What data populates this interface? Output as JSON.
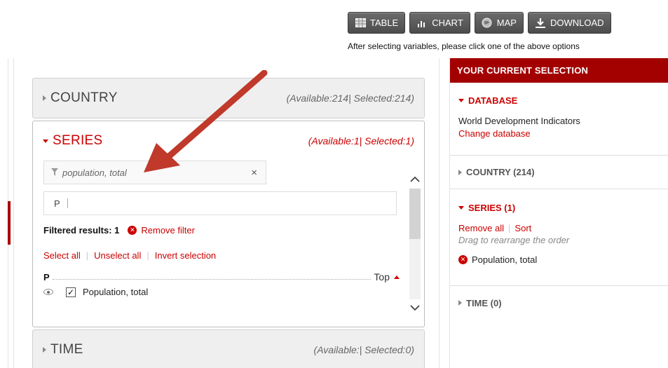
{
  "toolbar": {
    "table_label": "TABLE",
    "chart_label": "CHART",
    "map_label": "MAP",
    "download_label": "DOWNLOAD",
    "hint": "After selecting variables, please click one of the above options"
  },
  "panels": {
    "country": {
      "title": "COUNTRY",
      "availability": "(Available:214| Selected:214)"
    },
    "series": {
      "title": "SERIES",
      "availability": "(Available:1| Selected:1)"
    },
    "time": {
      "title": "TIME",
      "availability": "(Available:| Selected:0)"
    }
  },
  "series_panel": {
    "filter_tag": "population, total",
    "filter_clear": "×",
    "search_value": "P",
    "filtered_label": "Filtered results: 1",
    "remove_filter": "Remove filter",
    "select_all": "Select all",
    "unselect_all": "Unselect all",
    "invert_selection": "Invert selection",
    "group_letter": "P",
    "top_label": "Top",
    "items": [
      {
        "label": "Population, total",
        "checked": true
      }
    ]
  },
  "selection": {
    "header": "YOUR CURRENT SELECTION",
    "database": {
      "title": "DATABASE",
      "name": "World Development Indicators",
      "change": "Change database"
    },
    "country": {
      "title": "COUNTRY (214)"
    },
    "series": {
      "title": "SERIES (1)",
      "remove_all": "Remove all",
      "sort": "Sort",
      "hint": "Drag to rearrange the order",
      "items": [
        "Population, total"
      ]
    },
    "time": {
      "title": "TIME (0)"
    }
  },
  "colors": {
    "accent": "#a30000",
    "link": "#cc0000"
  }
}
